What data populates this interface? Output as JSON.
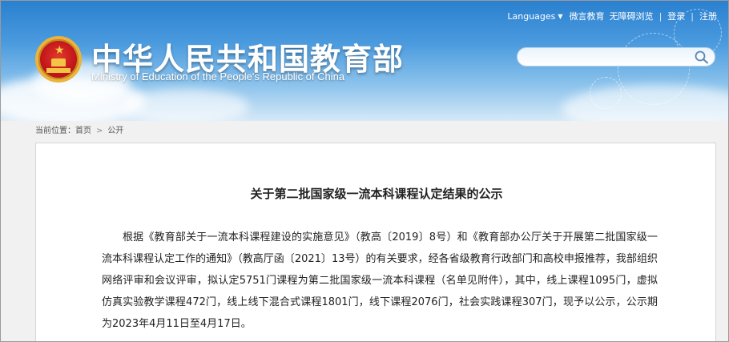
{
  "header": {
    "title_cn": "中华人民共和国教育部",
    "title_en": "Ministry of Education of the People's Republic of China",
    "links": {
      "languages": "Languages",
      "weibo": "微言教育",
      "accessible": "无障碍浏览",
      "login": "登录",
      "register": "注册"
    },
    "search_placeholder": ""
  },
  "breadcrumb": {
    "prefix": "当前位置：",
    "home": "首页",
    "section": "公开"
  },
  "article": {
    "title": "关于第二批国家级一流本科课程认定结果的公示",
    "body": "根据《教育部关于一流本科课程建设的实施意见》（教高〔2019〕8号）和《教育部办公厅关于开展第二批国家级一流本科课程认定工作的通知》（教高厅函〔2021〕13号）的有关要求，经各省级教育行政部门和高校申报推荐，我部组织网络评审和会议评审，拟认定5751门课程为第二批国家级一流本科课程（名单见附件），其中，线上课程1095门，虚拟仿真实验教学课程472门，线上线下混合式课程1801门，线下课程2076门，社会实践课程307门，现予以公示，公示期为2023年4月11日至4月17日。"
  },
  "colors": {
    "sky_top": "#2a80cf",
    "emblem_red": "#c4161c",
    "emblem_gold": "#e9b43c"
  }
}
